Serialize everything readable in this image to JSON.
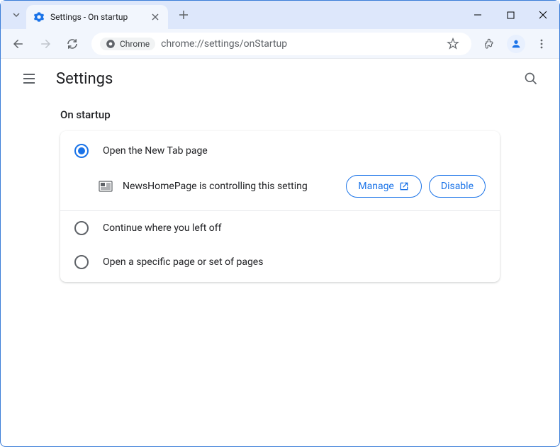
{
  "window": {
    "tab_title": "Settings - On startup",
    "chrome_chip_label": "Chrome",
    "url": "chrome://settings/onStartup"
  },
  "header": {
    "title": "Settings"
  },
  "section": {
    "title": "On startup",
    "options": {
      "new_tab": "Open the New Tab page",
      "continue": "Continue where you left off",
      "specific": "Open a specific page or set of pages"
    },
    "extension_notice": "NewsHomePage is controlling this setting",
    "manage_label": "Manage",
    "disable_label": "Disable"
  }
}
